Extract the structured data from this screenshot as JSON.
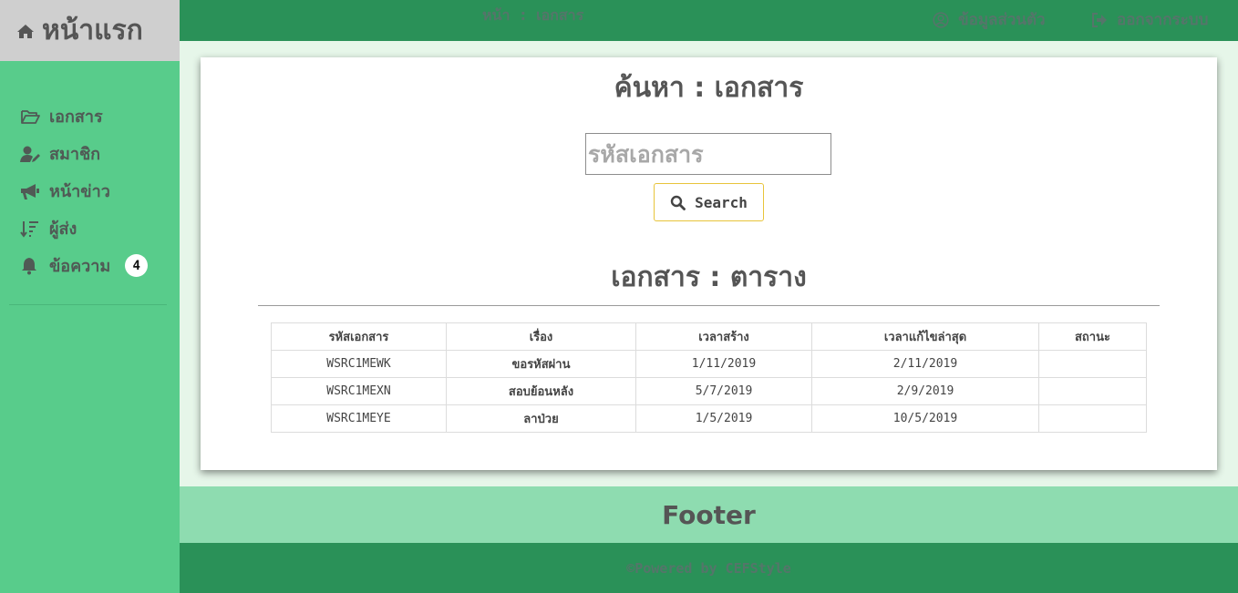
{
  "sidebar": {
    "brand": "หน้าแรก",
    "items": [
      {
        "label": "เอกสาร",
        "icon": "folder-open-icon"
      },
      {
        "label": "สมาชิก",
        "icon": "user-edit-icon"
      },
      {
        "label": "หน้าข่าว",
        "icon": "megaphone-icon"
      },
      {
        "label": "ผู้ส่ง",
        "icon": "sort-icon"
      },
      {
        "label": "ข้อความ",
        "icon": "bell-icon",
        "badge": "4"
      }
    ]
  },
  "topbar": {
    "breadcrumb": "หน้า  :  เอกสาร",
    "profile_label": "ข้อมูลส่วนตัว",
    "logout_label": "ออกจากระบบ"
  },
  "search": {
    "title": "ค้นหา : เอกสาร",
    "placeholder": "รหัสเอกสาร",
    "button_label": "Search"
  },
  "table": {
    "title": "เอกสาร : ตาราง",
    "headers": [
      "รหัสเอกสาร",
      "เรื่อง",
      "เวลาสร้าง",
      "เวลาแก้ไขล่าสุด",
      "สถานะ"
    ],
    "rows": [
      [
        "WSRC1MEWK",
        "ขอรหัสผ่าน",
        "1/11/2019",
        "2/11/2019",
        ""
      ],
      [
        "WSRC1MEXN",
        "สอบย้อนหลัง",
        "5/7/2019",
        "2/9/2019",
        ""
      ],
      [
        "WSRC1MEYE",
        "ลาป่วย",
        "1/5/2019",
        "10/5/2019",
        ""
      ]
    ]
  },
  "footer": {
    "title": "Footer",
    "credit": "©Powered by CEFStyle"
  },
  "colors": {
    "sidebar": "#58cc8b",
    "topbar": "#2a9158",
    "footer": "#8edcb0",
    "accent_button_border": "#e8c43a"
  }
}
